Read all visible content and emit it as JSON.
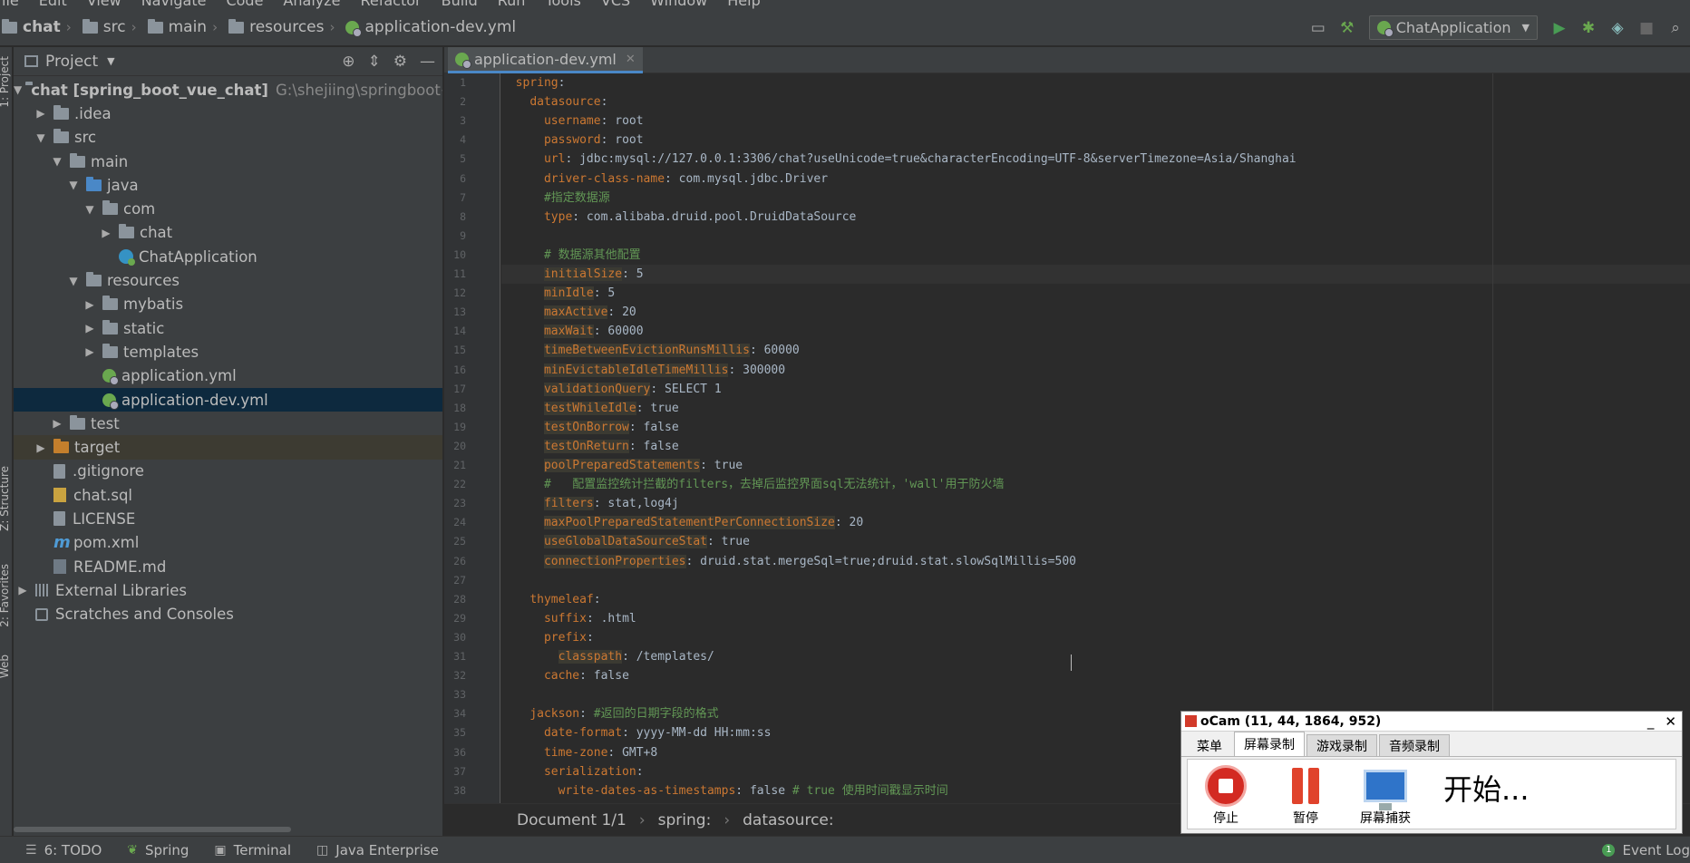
{
  "menu": {
    "items": [
      "ile",
      "Edit",
      "View",
      "Navigate",
      "Code",
      "Analyze",
      "Refactor",
      "Build",
      "Run",
      "Tools",
      "VCS",
      "Window",
      "Help"
    ]
  },
  "navbar": {
    "crumbs": [
      "chat",
      "src",
      "main",
      "resources",
      "application-dev.yml"
    ],
    "run_config": "ChatApplication"
  },
  "left_strip": {
    "project_label": "1: Project",
    "structure_label": "Z: Structure",
    "favorites_label": "2: Favorites",
    "web_label": "Web"
  },
  "project_panel": {
    "title": "Project",
    "tree": [
      {
        "label": "chat [spring_boot_vue_chat]",
        "path": "G:\\shejiing\\springboot+web"
      },
      {
        "label": ".idea"
      },
      {
        "label": "src"
      },
      {
        "label": "main"
      },
      {
        "label": "java"
      },
      {
        "label": "com"
      },
      {
        "label": "chat"
      },
      {
        "label": "ChatApplication"
      },
      {
        "label": "resources"
      },
      {
        "label": "mybatis"
      },
      {
        "label": "static"
      },
      {
        "label": "templates"
      },
      {
        "label": "application.yml"
      },
      {
        "label": "application-dev.yml"
      },
      {
        "label": "test"
      },
      {
        "label": "target"
      },
      {
        "label": ".gitignore"
      },
      {
        "label": "chat.sql"
      },
      {
        "label": "LICENSE"
      },
      {
        "label": "pom.xml"
      },
      {
        "label": "README.md"
      },
      {
        "label": "External Libraries"
      },
      {
        "label": "Scratches and Consoles"
      }
    ]
  },
  "editor": {
    "tab_label": "application-dev.yml",
    "current_line": 11,
    "lines": [
      {
        "n": "1",
        "key": "spring",
        "val": ""
      },
      {
        "n": "2",
        "key": "datasource",
        "val": ""
      },
      {
        "n": "3",
        "key": "username",
        "val": " root"
      },
      {
        "n": "4",
        "key": "password",
        "val": " root"
      },
      {
        "n": "5",
        "key": "url",
        "val": " jdbc:mysql://127.0.0.1:3306/chat?useUnicode=true&characterEncoding=UTF-8&serverTimezone=Asia/Shanghai"
      },
      {
        "n": "6",
        "key": "driver-class-name",
        "val": " com.mysql.jdbc.Driver"
      },
      {
        "n": "7",
        "comment": "#指定数据源"
      },
      {
        "n": "8",
        "key": "type",
        "val": " com.alibaba.druid.pool.DruidDataSource"
      },
      {
        "n": "9"
      },
      {
        "n": "10",
        "comment": "# 数据源其他配置"
      },
      {
        "n": "11",
        "key": "initialSize",
        "val": " 5"
      },
      {
        "n": "12",
        "key": "minIdle",
        "val": " 5"
      },
      {
        "n": "13",
        "key": "maxActive",
        "val": " 20"
      },
      {
        "n": "14",
        "key": "maxWait",
        "val": " 60000"
      },
      {
        "n": "15",
        "key": "timeBetweenEvictionRunsMillis",
        "val": " 60000"
      },
      {
        "n": "16",
        "key": "minEvictableIdleTimeMillis",
        "val": " 300000"
      },
      {
        "n": "17",
        "key": "validationQuery",
        "val": " SELECT 1"
      },
      {
        "n": "18",
        "key": "testWhileIdle",
        "val": " true"
      },
      {
        "n": "19",
        "key": "testOnBorrow",
        "val": " false"
      },
      {
        "n": "20",
        "key": "testOnReturn",
        "val": " false"
      },
      {
        "n": "21",
        "key": "poolPreparedStatements",
        "val": " true"
      },
      {
        "n": "22",
        "comment": "#   配置监控统计拦截的filters，去掉后监控界面sql无法统计，'wall'用于防火墙"
      },
      {
        "n": "23",
        "key": "filters",
        "val": " stat,log4j"
      },
      {
        "n": "24",
        "key": "maxPoolPreparedStatementPerConnectionSize",
        "val": " 20"
      },
      {
        "n": "25",
        "key": "useGlobalDataSourceStat",
        "val": " true"
      },
      {
        "n": "26",
        "key": "connectionProperties",
        "val": " druid.stat.mergeSql=true;druid.stat.slowSqlMillis=500"
      },
      {
        "n": "27"
      },
      {
        "n": "28",
        "key": "thymeleaf",
        "val": ""
      },
      {
        "n": "29",
        "key": "suffix",
        "val": " .html"
      },
      {
        "n": "30",
        "key": "prefix",
        "val": ""
      },
      {
        "n": "31",
        "key": "classpath",
        "val": " /templates/"
      },
      {
        "n": "32",
        "key": "cache",
        "val": " false"
      },
      {
        "n": "33"
      },
      {
        "n": "34",
        "key": "jackson",
        "val": " ",
        "comment": "#返回的日期字段的格式"
      },
      {
        "n": "35",
        "key": "date-format",
        "val": " yyyy-MM-dd HH:mm:ss"
      },
      {
        "n": "36",
        "key": "time-zone",
        "val": " GMT+8"
      },
      {
        "n": "37",
        "key": "serialization",
        "val": ""
      },
      {
        "n": "38",
        "key": "write-dates-as-timestamps",
        "val": " false ",
        "comment": "# true 使用时间戳显示时间"
      }
    ]
  },
  "breadcrumb": {
    "doc": "Document 1/1",
    "path": [
      "spring:",
      "datasource:"
    ]
  },
  "bottombar": {
    "todo": "6: TODO",
    "spring": "Spring",
    "terminal": "Terminal",
    "java_enterprise": "Java Enterprise",
    "event_log": "Event Log",
    "event_count": "1"
  },
  "ocam": {
    "title": "oCam (11, 44, 1864, 952)",
    "tabs": [
      "菜单",
      "屏幕录制",
      "游戏录制",
      "音频录制"
    ],
    "active_tab": "屏幕录制",
    "buttons": [
      "停止",
      "暂停",
      "屏幕捕获"
    ],
    "status": "开始..."
  }
}
